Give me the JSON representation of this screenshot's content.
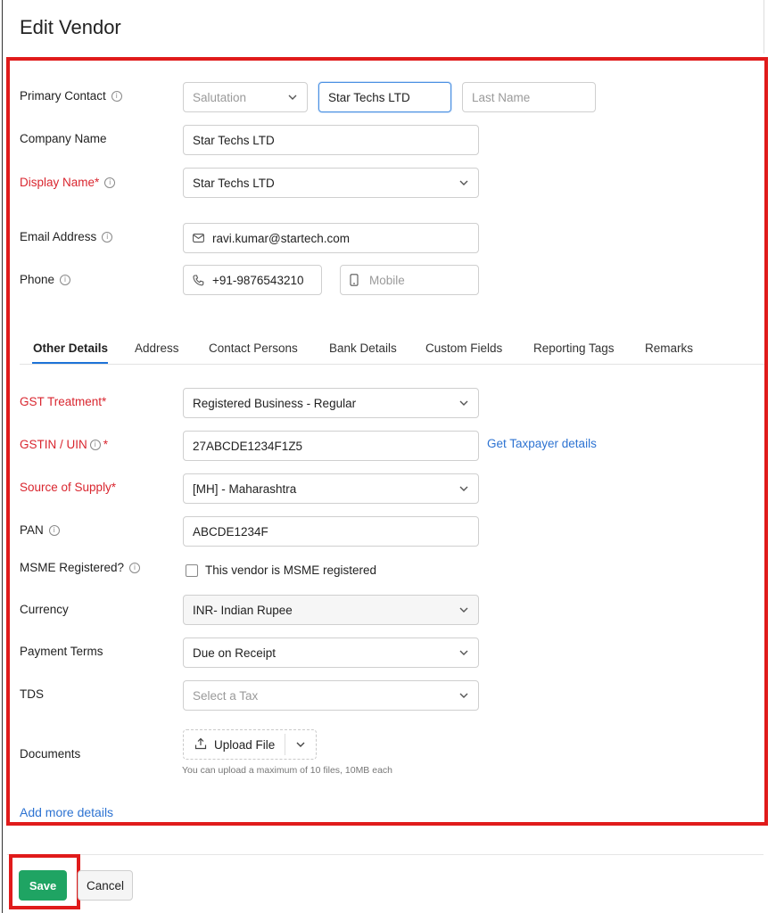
{
  "page": {
    "title": "Edit Vendor"
  },
  "form": {
    "primary_contact": {
      "label": "Primary Contact",
      "salutation_placeholder": "Salutation",
      "first_name": "Star Techs LTD",
      "last_name_placeholder": "Last Name"
    },
    "company_name": {
      "label": "Company Name",
      "value": "Star Techs LTD"
    },
    "display_name": {
      "label": "Display Name*",
      "value": "Star Techs LTD"
    },
    "email": {
      "label": "Email Address",
      "value": "ravi.kumar@startech.com"
    },
    "phone": {
      "label": "Phone",
      "work_value": "+91-9876543210",
      "mobile_placeholder": "Mobile"
    }
  },
  "tabs": [
    "Other Details",
    "Address",
    "Contact Persons",
    "Bank Details",
    "Custom Fields",
    "Reporting Tags",
    "Remarks"
  ],
  "other_details": {
    "gst_treatment": {
      "label": "GST Treatment*",
      "value": "Registered Business - Regular"
    },
    "gstin": {
      "label": "GSTIN / UIN",
      "required_mark": "*",
      "value": "27ABCDE1234F1Z5",
      "link": "Get Taxpayer details"
    },
    "source_of_supply": {
      "label": "Source of Supply*",
      "value": "[MH] - Maharashtra"
    },
    "pan": {
      "label": "PAN",
      "value": "ABCDE1234F"
    },
    "msme": {
      "label": "MSME Registered?",
      "checkbox_label": "This vendor is MSME registered"
    },
    "currency": {
      "label": "Currency",
      "value": "INR- Indian Rupee"
    },
    "payment_terms": {
      "label": "Payment Terms",
      "value": "Due on Receipt"
    },
    "tds": {
      "label": "TDS",
      "placeholder": "Select a Tax"
    },
    "documents": {
      "label": "Documents",
      "upload_label": "Upload File",
      "hint": "You can upload a maximum of 10 files, 10MB each"
    },
    "add_more": "Add more details"
  },
  "footer": {
    "save": "Save",
    "cancel": "Cancel"
  },
  "colors": {
    "accent_red": "#e01b1b",
    "required_red": "#d9262f",
    "link_blue": "#2d73d2",
    "save_green": "#1fa463"
  }
}
